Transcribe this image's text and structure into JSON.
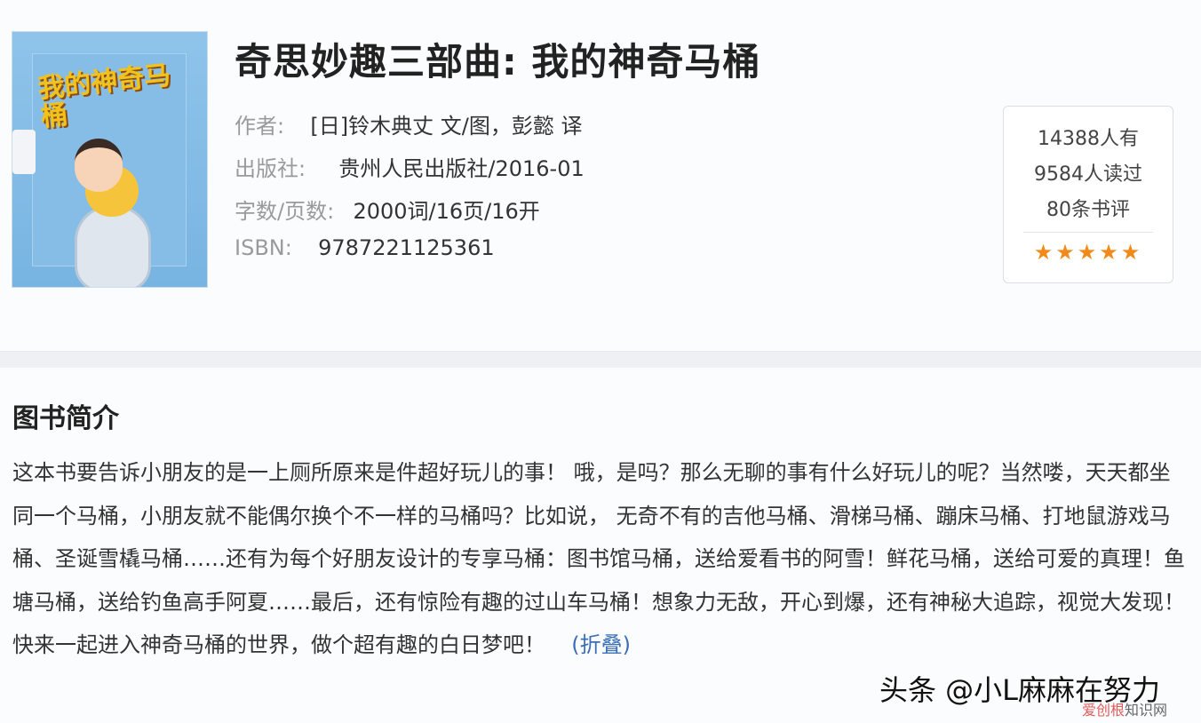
{
  "book": {
    "cover_title": "我的神奇马桶",
    "title": "奇思妙趣三部曲: 我的神奇马桶",
    "meta": [
      {
        "label": "作者:",
        "value": "[日]铃木典丈 文/图，彭懿 译"
      },
      {
        "label": "出版社:",
        "value": "贵州人民出版社/2016-01"
      },
      {
        "label": "字数/页数:",
        "value": "2000词/16页/16开"
      },
      {
        "label": "ISBN:",
        "value": "9787221125361"
      }
    ]
  },
  "stats": {
    "have": "14388人有",
    "read": "9584人读过",
    "reviews": "80条书评",
    "stars_text": "★★★★★",
    "rating": 5,
    "star_color": "#f28a1a"
  },
  "intro": {
    "heading": "图书简介",
    "body": "这本书要告诉小朋友的是一上厕所原来是件超好玩儿的事！ 哦，是吗？那么无聊的事有什么好玩儿的呢？当然喽，天天都坐同一个马桶，小朋友就不能偶尔换个不一样的马桶吗？比如说， 无奇不有的吉他马桶、滑梯马桶、蹦床马桶、打地鼠游戏马桶、圣诞雪橇马桶……还有为每个好朋友设计的专享马桶：图书馆马桶，送给爱看书的阿雪！鲜花马桶，送给可爱的真理！鱼塘马桶，送给钓鱼高手阿夏……最后，还有惊险有趣的过山车马桶！想象力无敌，开心到爆，还有神秘大追踪，视觉大发现！快来一起进入神奇马桶的世界，做个超有趣的白日梦吧！",
    "fold_label": "(折叠)"
  },
  "watermark": {
    "main": "头条 @小L麻麻在努力",
    "sub_accent": "爱创根",
    "sub_rest": "知识网"
  }
}
